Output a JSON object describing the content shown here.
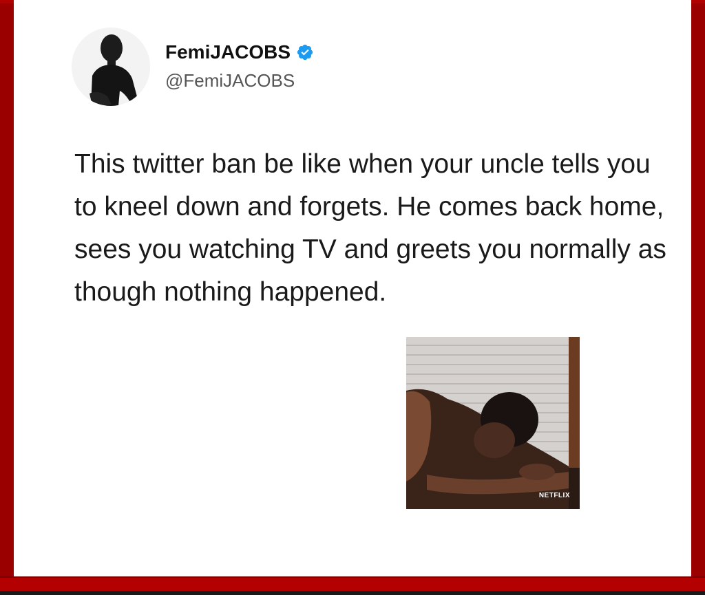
{
  "tweet": {
    "author": {
      "display_name": "FemiJACOBS",
      "handle": "@FemiJACOBS",
      "verified": true
    },
    "text": "This twitter ban be like when your uncle tells you to kneel down and forgets. He comes back home, sees you watching TV and greets you normally as though nothing happened.",
    "media": {
      "watermark": "NETFLIX"
    }
  },
  "icons": {
    "verified": "verified-badge-icon",
    "avatar": "profile-photo"
  },
  "colors": {
    "frame": "#9b0000",
    "verified": "#1d9bf0",
    "text": "#1a1a1a",
    "handle": "#555555"
  }
}
